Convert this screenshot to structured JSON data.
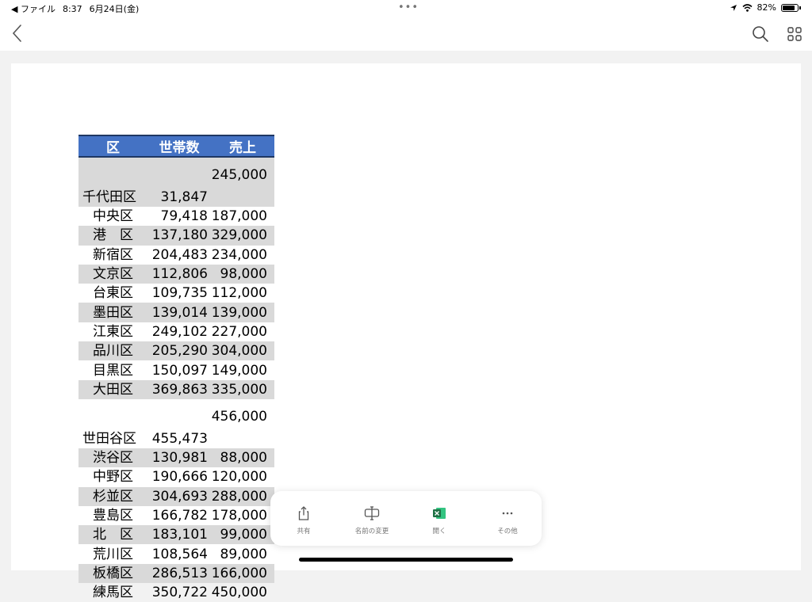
{
  "status_bar": {
    "back_app": "◀ ファイル",
    "time": "8:37",
    "date": "6月24日(金)",
    "multitask_dots": "•••",
    "battery_percent": "82%",
    "battery_level": 0.82
  },
  "nav": {
    "back_icon": "chevron-left-icon",
    "search_icon": "search-icon",
    "grid_icon": "grid-icon"
  },
  "table": {
    "headers": [
      "区",
      "世帯数",
      "売上"
    ],
    "rows": [
      {
        "ward": "千代田区",
        "households": "31,847",
        "sales": "245,000"
      },
      {
        "ward": "中央区",
        "households": "79,418",
        "sales": "187,000"
      },
      {
        "ward": "港　区",
        "households": "137,180",
        "sales": "329,000"
      },
      {
        "ward": "新宿区",
        "households": "204,483",
        "sales": "234,000"
      },
      {
        "ward": "文京区",
        "households": "112,806",
        "sales": "98,000"
      },
      {
        "ward": "台東区",
        "households": "109,735",
        "sales": "112,000"
      },
      {
        "ward": "墨田区",
        "households": "139,014",
        "sales": "139,000"
      },
      {
        "ward": "江東区",
        "households": "249,102",
        "sales": "227,000"
      },
      {
        "ward": "品川区",
        "households": "205,290",
        "sales": "304,000"
      },
      {
        "ward": "目黒区",
        "households": "150,097",
        "sales": "149,000"
      },
      {
        "ward": "大田区",
        "households": "369,863",
        "sales": "335,000"
      },
      {
        "ward": "世田谷区",
        "households": "455,473",
        "sales": "456,000"
      },
      {
        "ward": "渋谷区",
        "households": "130,981",
        "sales": "88,000"
      },
      {
        "ward": "中野区",
        "households": "190,666",
        "sales": "120,000"
      },
      {
        "ward": "杉並区",
        "households": "304,693",
        "sales": "288,000"
      },
      {
        "ward": "豊島区",
        "households": "166,782",
        "sales": "178,000"
      },
      {
        "ward": "北　区",
        "households": "183,101",
        "sales": "99,000"
      },
      {
        "ward": "荒川区",
        "households": "108,564",
        "sales": "89,000"
      },
      {
        "ward": "板橋区",
        "households": "286,513",
        "sales": "166,000"
      },
      {
        "ward": "練馬区",
        "households": "350,722",
        "sales": "450,000"
      }
    ]
  },
  "action_bar": {
    "items": [
      {
        "label": "共有",
        "icon": "share-icon"
      },
      {
        "label": "名前の変更",
        "icon": "rename-icon"
      },
      {
        "label": "開く",
        "icon": "excel-icon"
      },
      {
        "label": "その他",
        "icon": "more-icon"
      }
    ]
  },
  "colors": {
    "header_bg": "#4472c4",
    "header_border": "#1f3763",
    "row_shade": "#d9d9d9",
    "excel_green": "#1e7145"
  }
}
